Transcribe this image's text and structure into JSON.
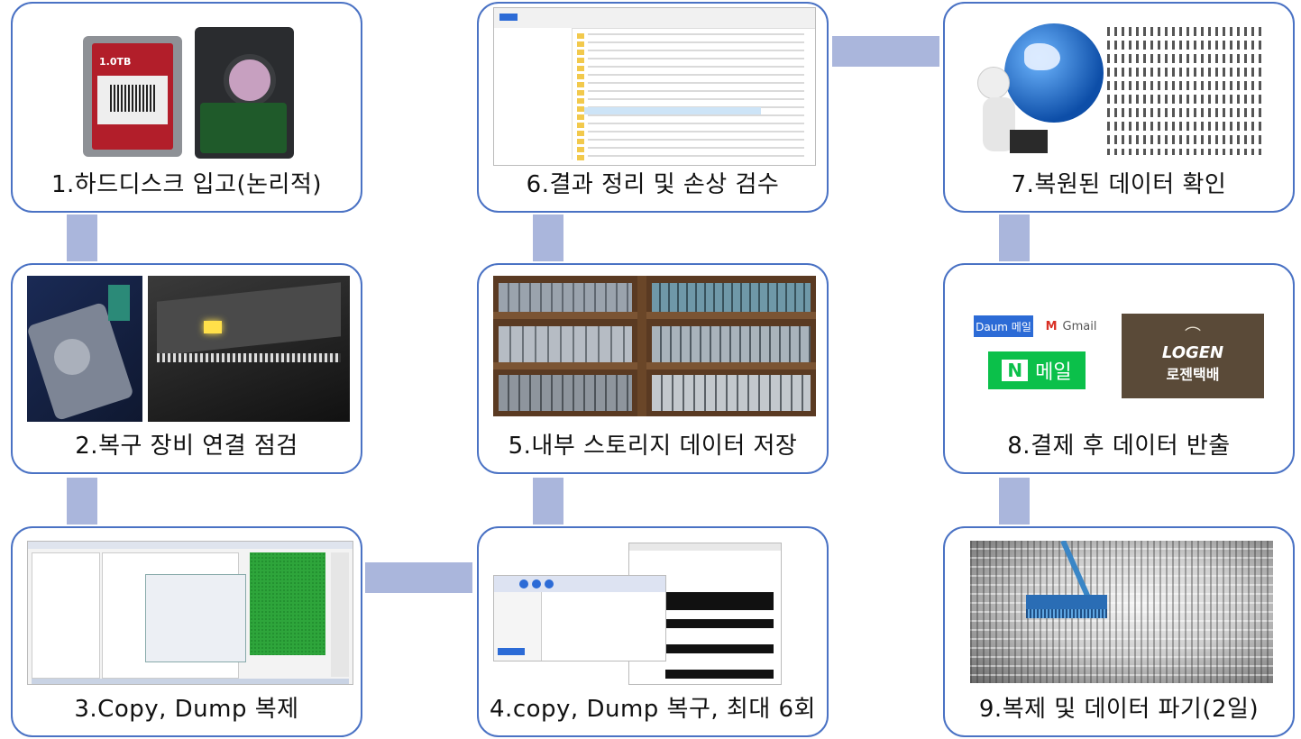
{
  "steps": [
    {
      "id": 1,
      "label": "1.하드디스크 입고(논리적)"
    },
    {
      "id": 2,
      "label": "2.복구 장비 연결 점검"
    },
    {
      "id": 3,
      "label": "3.Copy, Dump 복제"
    },
    {
      "id": 4,
      "label": "4.copy, Dump 복구, 최대 6회"
    },
    {
      "id": 5,
      "label": "5.내부 스토리지 데이터 저장"
    },
    {
      "id": 6,
      "label": "6.결과 정리 및 손상 검수"
    },
    {
      "id": 7,
      "label": "7.복원된 데이터 확인"
    },
    {
      "id": 8,
      "label": "8.결제 후 데이터 반출"
    },
    {
      "id": 9,
      "label": "9.복제 및 데이터 파기(2일)"
    }
  ],
  "logos": {
    "daum": "Daum 메일",
    "gmail": "Gmail",
    "naver_n": "N",
    "naver_mail": "메일",
    "logen": "LOGEN",
    "logen_kr": "로젠택배"
  },
  "hdd_label": "1.0TB",
  "colors": {
    "border": "#4a72c4",
    "connector": "#aab6dc",
    "caption": "#111111"
  }
}
